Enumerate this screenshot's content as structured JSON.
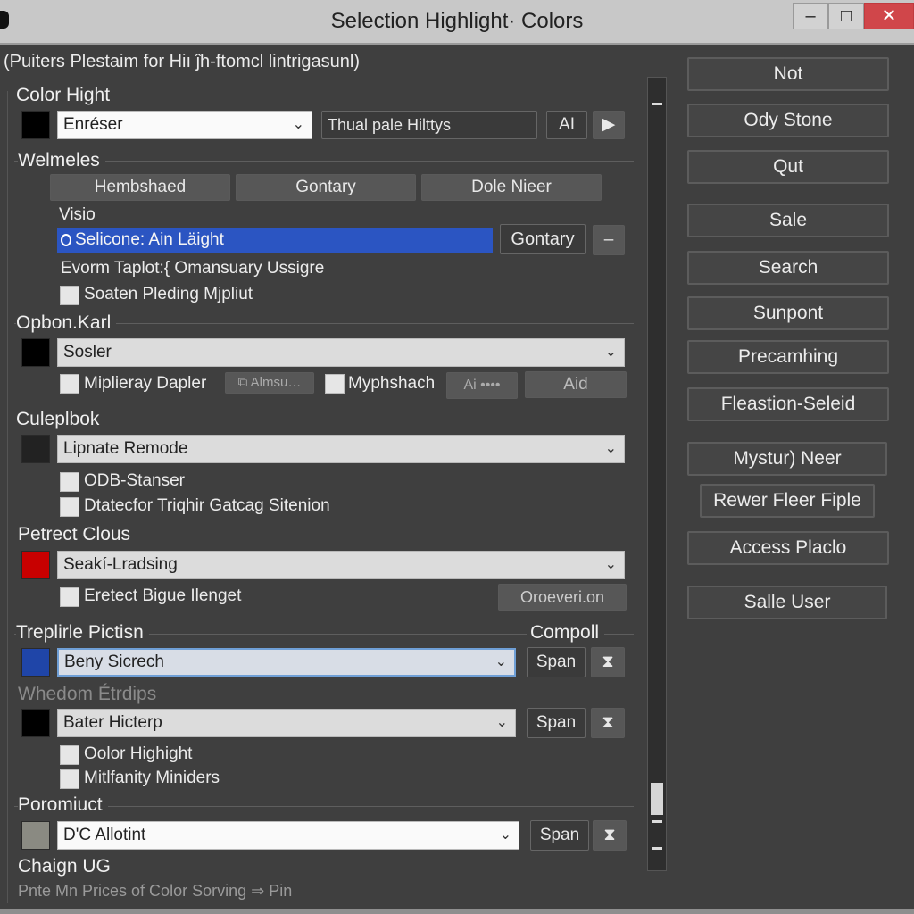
{
  "window": {
    "title": "Selection Highlight· Colors",
    "controls": {
      "minimize": "–",
      "maximize": "□",
      "close": "✕"
    }
  },
  "subtitle": "(Puiters Plestaim for Hiı ĵh-ftomcl lintrigasunl)",
  "groups": {
    "color_hight": {
      "label": "Color Hight",
      "swatch": "#000000",
      "combo_value": "Enréser",
      "text_field_value": "Thual pale Hilttys",
      "ai_button": "AI",
      "play_icon": "▶"
    },
    "welmeles": {
      "label": "Welmeles",
      "buttons": [
        "Hembshaed",
        "Gontary",
        "Dole Nieer"
      ],
      "sub_label": "Visio",
      "selected_item": "Selicone: Ain Läight",
      "gontary_button": "Gontary",
      "spin_icon": "–",
      "info_line": "Evorm Taplot:{ Omansuary Ussigre",
      "checkbox": "Soaten Pleding Mjpliut"
    },
    "opbon_karl": {
      "label": "Opbon.Karl",
      "swatch": "#000000",
      "combo_value": "Sosler",
      "checkbox1": "Miplieray Dapler",
      "alms_button": "⧉ Almsu…",
      "checkbox2": "Myphshach",
      "ai_more_button": "Ai ••••",
      "aid_button": "Aid"
    },
    "culeplbook": {
      "label": "Culeplbok",
      "swatch": "#222222",
      "combo_value": "Lipnate Remode",
      "checkbox1": "ODB-Stanser",
      "checkbox2": "Dtatecfor Triqhir Gatcag Sitenion"
    },
    "petrect_clous": {
      "label": "Petrect Clous",
      "swatch": "#c80000",
      "combo_value": "Seakí-Lradsing",
      "checkbox": "Eretect Bigue Ilenget",
      "button": "Oroeveri.on"
    },
    "treplirle": {
      "label": "Treplirle Pictisn",
      "right_label": "Compoll",
      "swatch": "#1f45a8",
      "combo_value": "Beny Sicrech",
      "span_button": "Span",
      "spin_icon": "⧗"
    },
    "whedom": {
      "label": "Whedom Étrdips",
      "swatch": "#000000",
      "combo_value": "Bater Hicterp",
      "span_button": "Span",
      "spin_icon": "⧗",
      "checkbox1": "Oolor Highight",
      "checkbox2": "Mitlfanity Miniders"
    },
    "poromiuct": {
      "label": "Poromiuct",
      "swatch": "#8a8a82",
      "combo_value": "D'C Allotint",
      "span_button": "Span",
      "spin_icon": "⧗"
    },
    "chaign": {
      "label": "Chaign UG",
      "footer_text": "Pnte Mn Prices of Color Sorving ⇒ Pin"
    }
  },
  "side_buttons": [
    "Not",
    "Ody Stone",
    "Qut",
    "Sale",
    "Search",
    "Sunpont",
    "Precamhing",
    "Fleastion-Seleid",
    "Mystur) Neer",
    "Rewer Fleer Fiple",
    "Access Placlo",
    "Salle User"
  ],
  "chevron": "⌄"
}
